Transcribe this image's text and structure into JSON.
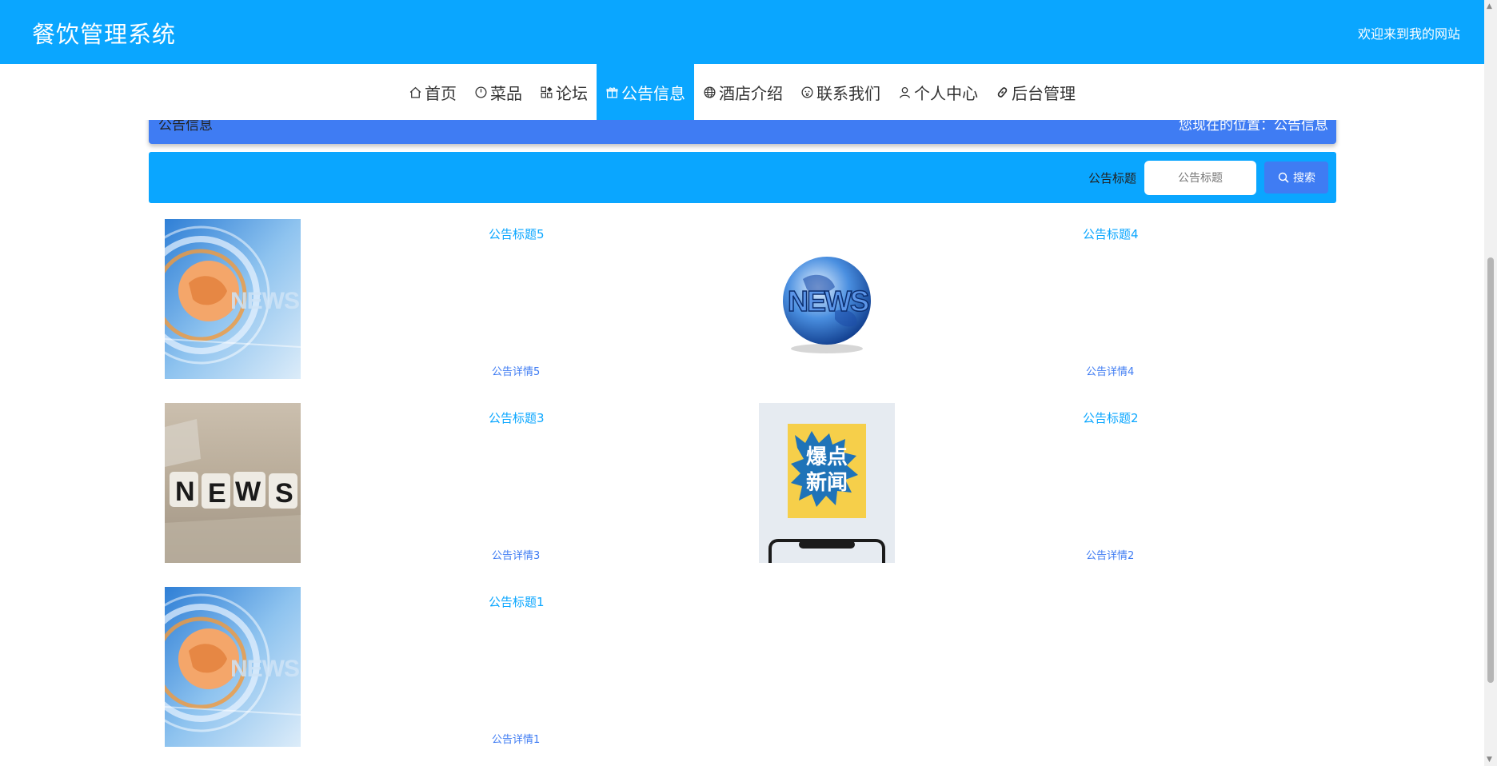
{
  "header": {
    "site_title": "餐饮管理系统",
    "welcome": "欢迎来到我的网站"
  },
  "nav": {
    "items": [
      {
        "label": "首页",
        "icon": "home-icon"
      },
      {
        "label": "菜品",
        "icon": "clock-icon"
      },
      {
        "label": "论坛",
        "icon": "grid-icon"
      },
      {
        "label": "公告信息",
        "icon": "gift-icon",
        "active": true
      },
      {
        "label": "酒店介绍",
        "icon": "globe-icon"
      },
      {
        "label": "联系我们",
        "icon": "smile-icon"
      },
      {
        "label": "个人中心",
        "icon": "user-icon"
      },
      {
        "label": "后台管理",
        "icon": "link-icon"
      }
    ]
  },
  "breadcrumb": {
    "title": "公告信息",
    "location": "您现在的位置：公告信息"
  },
  "search": {
    "label": "公告标题",
    "placeholder": "公告标题",
    "button_label": "搜索",
    "button_icon": "search-icon"
  },
  "notices": [
    {
      "title": "公告标题5",
      "detail": "公告详情5",
      "image": "news-broadcast-image"
    },
    {
      "title": "公告标题4",
      "detail": "公告详情4",
      "image": "news-globe-image"
    },
    {
      "title": "公告标题3",
      "detail": "公告详情3",
      "image": "news-cubes-image"
    },
    {
      "title": "公告标题2",
      "detail": "公告详情2",
      "image": "breaking-news-poster-image",
      "poster_text_1": "爆点",
      "poster_text_2": "新闻"
    },
    {
      "title": "公告标题1",
      "detail": "公告详情1",
      "image": "news-broadcast-image"
    }
  ],
  "colors": {
    "primary": "#0aa6ff",
    "accent": "#3f7cf3"
  }
}
